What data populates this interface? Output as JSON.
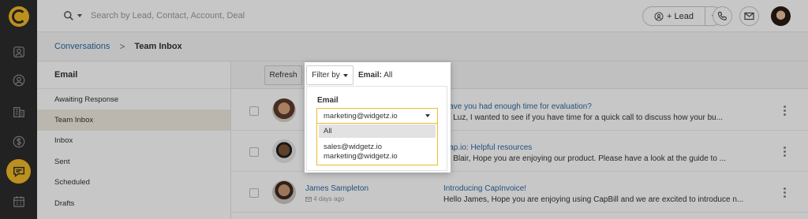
{
  "rail": {
    "items": [
      "logo-icon",
      "contacts-icon",
      "accounts-icon",
      "company-icon",
      "deals-icon",
      "conversations-icon",
      "calendar-icon"
    ]
  },
  "topbar": {
    "search_placeholder": "Search by Lead, Contact, Account, Deal",
    "lead_label": "+ Lead"
  },
  "breadcrumb": {
    "parent": "Conversations",
    "separator": ">",
    "current": "Team Inbox"
  },
  "sidebar": {
    "title": "Email",
    "items": [
      {
        "label": "Awaiting Response"
      },
      {
        "label": "Team Inbox",
        "active": true
      },
      {
        "label": "Inbox"
      },
      {
        "label": "Sent"
      },
      {
        "label": "Scheduled"
      },
      {
        "label": "Drafts"
      }
    ]
  },
  "toolbar": {
    "refresh_label": "Refresh",
    "filter_label": "Filter by",
    "filter_key": "Email:",
    "filter_value": "All"
  },
  "filter_popup": {
    "section_label": "Email",
    "selected_value": "marketing@widgetz.io",
    "options": [
      "All",
      "sales@widgetz.io",
      "marketing@widgetz.io"
    ],
    "highlighted_option": "All"
  },
  "messages": [
    {
      "name": "",
      "time": "",
      "subject": "Have you had enough time for evaluation?",
      "preview": "Hi Luz,  I wanted to see if you have time for a quick call to discuss how your bu..."
    },
    {
      "name": "",
      "time": "",
      "subject": "Cap.io: Helpful resources",
      "preview": "Hi Blair, Hope you are enjoying our product. Please have a look at the guide to ..."
    },
    {
      "name": "James Sampleton",
      "time": "4 days ago",
      "subject": "Introducing CapInvoice!",
      "preview": "Hello James, Hope you are enjoying using CapBill and we are excited to introduce n..."
    }
  ],
  "colors": {
    "accent": "#f1b927",
    "link": "#2d6a9f",
    "rail_bg": "#2c2c2c"
  }
}
